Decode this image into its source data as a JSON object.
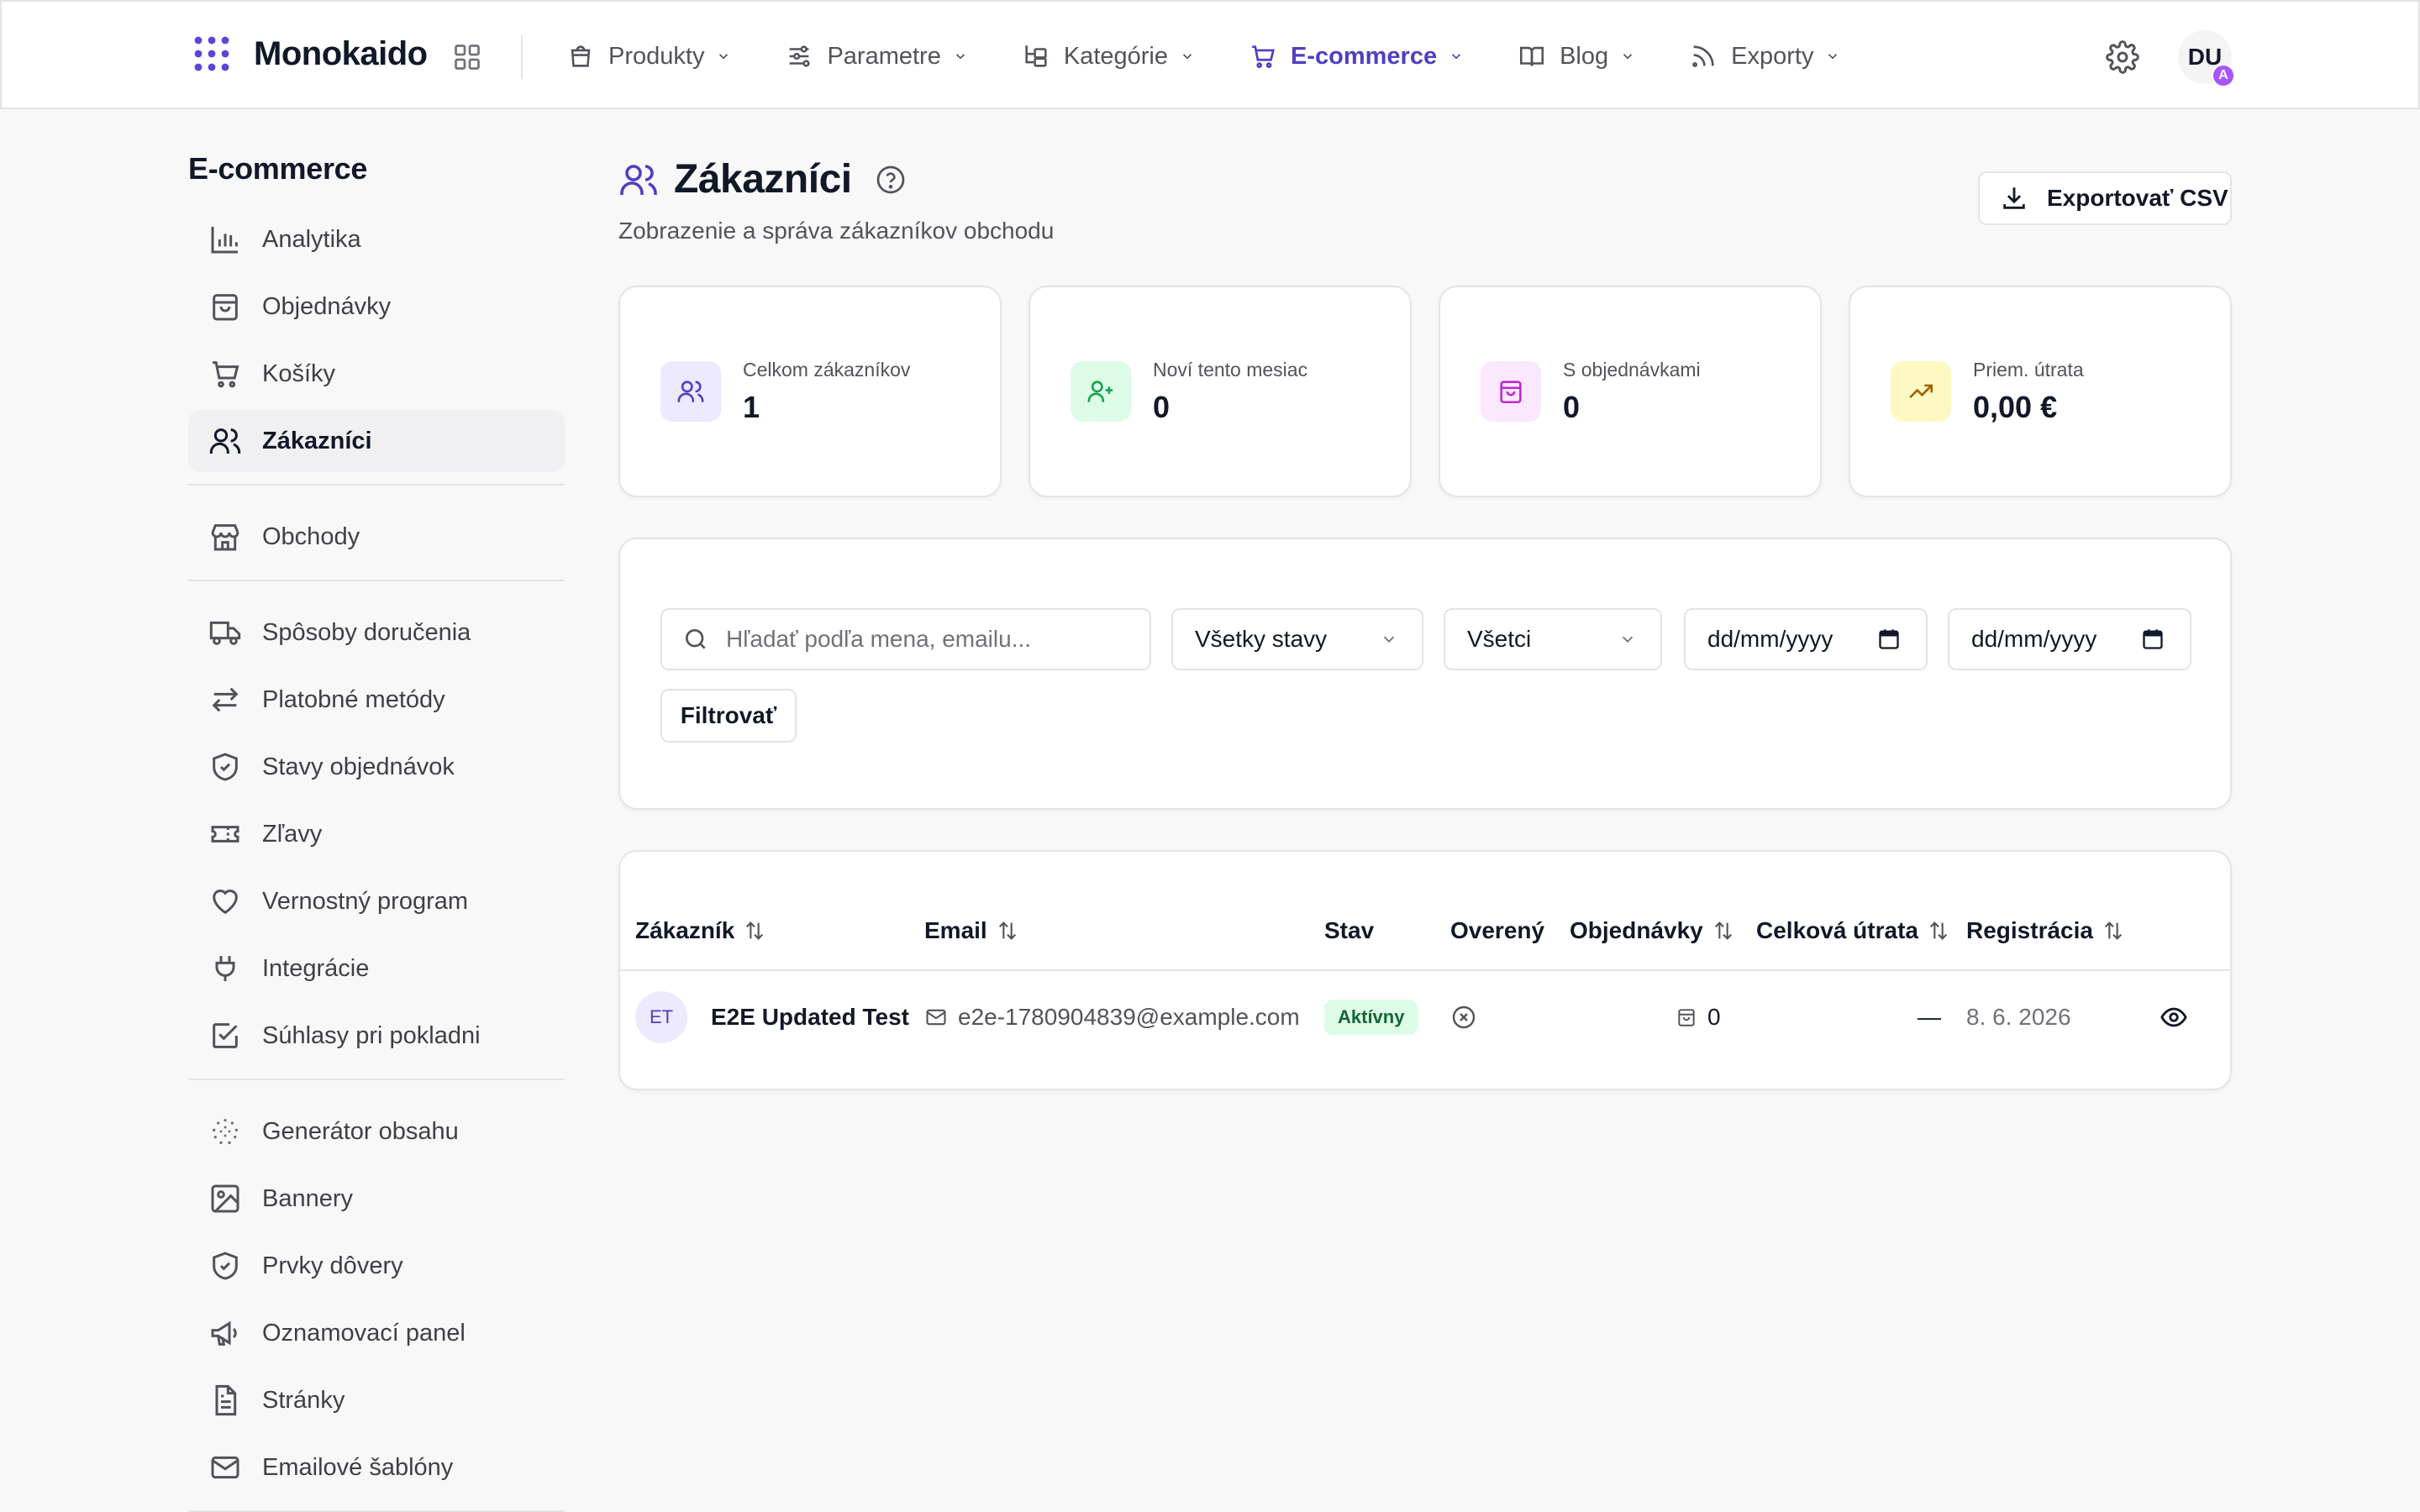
{
  "app": {
    "brand": "Monokaido",
    "user_initials": "DU",
    "user_badge": "A"
  },
  "topnav": {
    "items": [
      {
        "label": "Produkty",
        "icon": "shopping-bag-icon"
      },
      {
        "label": "Parametre",
        "icon": "sliders-icon"
      },
      {
        "label": "Kategórie",
        "icon": "category-tree-icon"
      },
      {
        "label": "E-commerce",
        "icon": "cart-icon",
        "active": true
      },
      {
        "label": "Blog",
        "icon": "book-icon"
      },
      {
        "label": "Exporty",
        "icon": "rss-icon"
      }
    ]
  },
  "sidebar": {
    "title": "E-commerce",
    "groups": [
      [
        {
          "label": "Analytika",
          "icon": "bar-chart-icon"
        },
        {
          "label": "Objednávky",
          "icon": "shopping-bag-icon"
        },
        {
          "label": "Košíky",
          "icon": "cart-icon"
        },
        {
          "label": "Zákazníci",
          "icon": "users-icon",
          "active": true
        }
      ],
      [
        {
          "label": "Obchody",
          "icon": "store-icon"
        }
      ],
      [
        {
          "label": "Spôsoby doručenia",
          "icon": "truck-icon"
        },
        {
          "label": "Platobné metódy",
          "icon": "arrows-exchange-icon"
        },
        {
          "label": "Stavy objednávok",
          "icon": "shield-check-icon"
        },
        {
          "label": "Zľavy",
          "icon": "ticket-icon"
        },
        {
          "label": "Vernostný program",
          "icon": "heart-icon"
        },
        {
          "label": "Integrácie",
          "icon": "plug-icon"
        },
        {
          "label": "Súhlasy pri pokladni",
          "icon": "checkbox-icon"
        }
      ],
      [
        {
          "label": "Generátor obsahu",
          "icon": "sparkle-dots-icon"
        },
        {
          "label": "Bannery",
          "icon": "image-icon"
        },
        {
          "label": "Prvky dôvery",
          "icon": "shield-check-icon"
        },
        {
          "label": "Oznamovací panel",
          "icon": "megaphone-icon"
        },
        {
          "label": "Stránky",
          "icon": "document-icon"
        },
        {
          "label": "Emailové šablóny",
          "icon": "mail-icon"
        }
      ]
    ]
  },
  "page": {
    "title": "Zákazníci",
    "subtitle": "Zobrazenie a správa zákazníkov obchodu",
    "export_label": "Exportovať CSV"
  },
  "stats": [
    {
      "label": "Celkom zákazníkov",
      "value": "1",
      "icon": "users-icon",
      "bg": "#ede9fe",
      "color": "#4f3fc1"
    },
    {
      "label": "Noví tento mesiac",
      "value": "0",
      "icon": "user-plus-icon",
      "bg": "#dcfce7",
      "color": "#16a34a"
    },
    {
      "label": "S objednávkami",
      "value": "0",
      "icon": "shopping-bag-icon",
      "bg": "#fae8ff",
      "color": "#c026d3"
    },
    {
      "label": "Priem. útrata",
      "value": "0,00 €",
      "icon": "trending-up-icon",
      "bg": "#fef9c3",
      "color": "#a16207"
    }
  ],
  "filters": {
    "search_placeholder": "Hľadať podľa mena, emailu...",
    "status_select": "Všetky stavy",
    "verified_select": "Všetci",
    "date_from": "dd/mm/yyyy",
    "date_to": "dd/mm/yyyy",
    "filter_button": "Filtrovať"
  },
  "table": {
    "columns": [
      "Zákazník",
      "Email",
      "Stav",
      "Overený",
      "Objednávky",
      "Celková útrata",
      "Registrácia"
    ],
    "rows": [
      {
        "initials": "ET",
        "name": "E2E Updated Test",
        "email": "e2e-1780904839@example.com",
        "status": "Aktívny",
        "verified": "not-verified",
        "orders": "0",
        "total": "—",
        "registered": "8. 6. 2026"
      }
    ]
  }
}
